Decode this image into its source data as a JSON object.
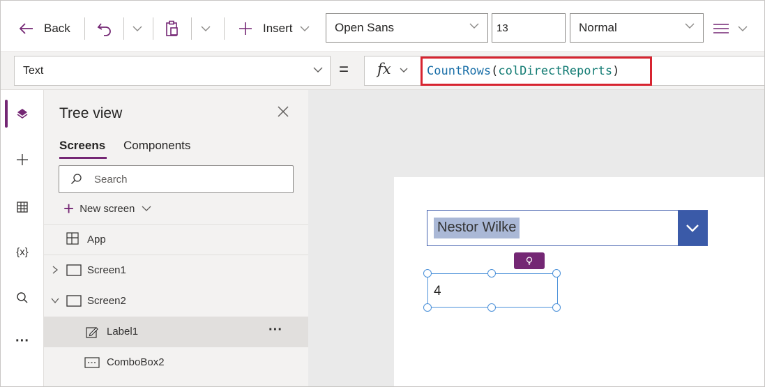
{
  "toolbar": {
    "back_label": "Back",
    "insert_label": "Insert",
    "font": "Open Sans",
    "font_size": "13",
    "weight": "Normal"
  },
  "formula_bar": {
    "property": "Text",
    "equals": "=",
    "fx": "fx",
    "formula_fn": "CountRows",
    "formula_open": "(",
    "formula_arg": "colDirectReports",
    "formula_close": ")"
  },
  "tree": {
    "title": "Tree view",
    "tabs": [
      "Screens",
      "Components"
    ],
    "search_placeholder": "Search",
    "new_screen": "New screen",
    "nodes": [
      "App",
      "Screen1",
      "Screen2",
      "Label1",
      "ComboBox2"
    ],
    "more": "···"
  },
  "canvas": {
    "combo_value": "Nestor Wilke",
    "label_value": "4"
  },
  "rail": {
    "more": "···",
    "variables": "{x}"
  },
  "colors": {
    "accent": "#742774",
    "highlight_border": "#d72430",
    "combo_button": "#3a5aa8",
    "selection_handles": "#4a90d9"
  }
}
